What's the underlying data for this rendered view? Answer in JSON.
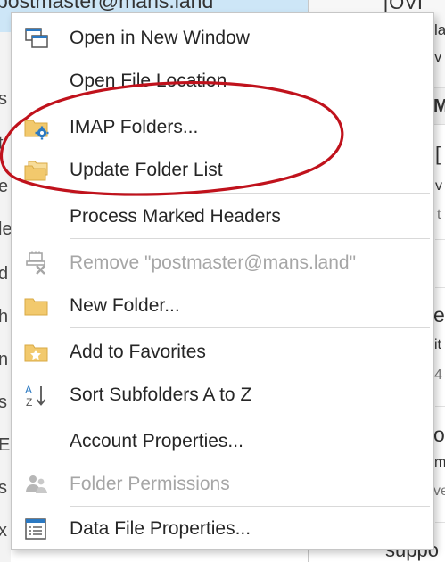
{
  "background": {
    "account_header": "postmaster@mans.land",
    "right_fragments": [
      "[OVI",
      "la",
      "v",
      "M",
      "[",
      "v",
      "t",
      "e",
      "it",
      "4",
      "o",
      "m",
      "ve",
      "suppo"
    ],
    "left_fragments": [
      "s",
      "t",
      "e",
      "le",
      "d",
      "h",
      "n",
      "s",
      "Ei",
      "s",
      "x"
    ]
  },
  "menu": {
    "items": [
      {
        "label": "Open in New Window",
        "disabled": false,
        "icon": "new-window-icon"
      },
      {
        "label": "Open File Location",
        "disabled": false,
        "icon": ""
      },
      {
        "label": "IMAP Folders...",
        "disabled": false,
        "icon": "folder-gear-icon"
      },
      {
        "label": "Update Folder List",
        "disabled": false,
        "icon": "folders-icon"
      },
      {
        "label": "Process Marked Headers",
        "disabled": false,
        "icon": ""
      },
      {
        "label": "Remove \"postmaster@mans.land\"",
        "disabled": true,
        "icon": "remove-account-icon"
      },
      {
        "label": "New Folder...",
        "disabled": false,
        "icon": "folder-icon"
      },
      {
        "label": "Add to Favorites",
        "disabled": false,
        "icon": "folder-star-icon"
      },
      {
        "label": "Sort Subfolders A to Z",
        "disabled": false,
        "icon": "sort-az-icon"
      },
      {
        "label": "Account Properties...",
        "disabled": false,
        "icon": ""
      },
      {
        "label": "Folder Permissions",
        "disabled": true,
        "icon": "users-icon"
      },
      {
        "label": "Data File Properties...",
        "disabled": false,
        "icon": "list-window-icon"
      }
    ]
  },
  "colors": {
    "annotation": "#c0121c",
    "folder": "#f2c96d",
    "icon_blue": "#2b79c2",
    "disabled_text": "#a6a6a6"
  }
}
